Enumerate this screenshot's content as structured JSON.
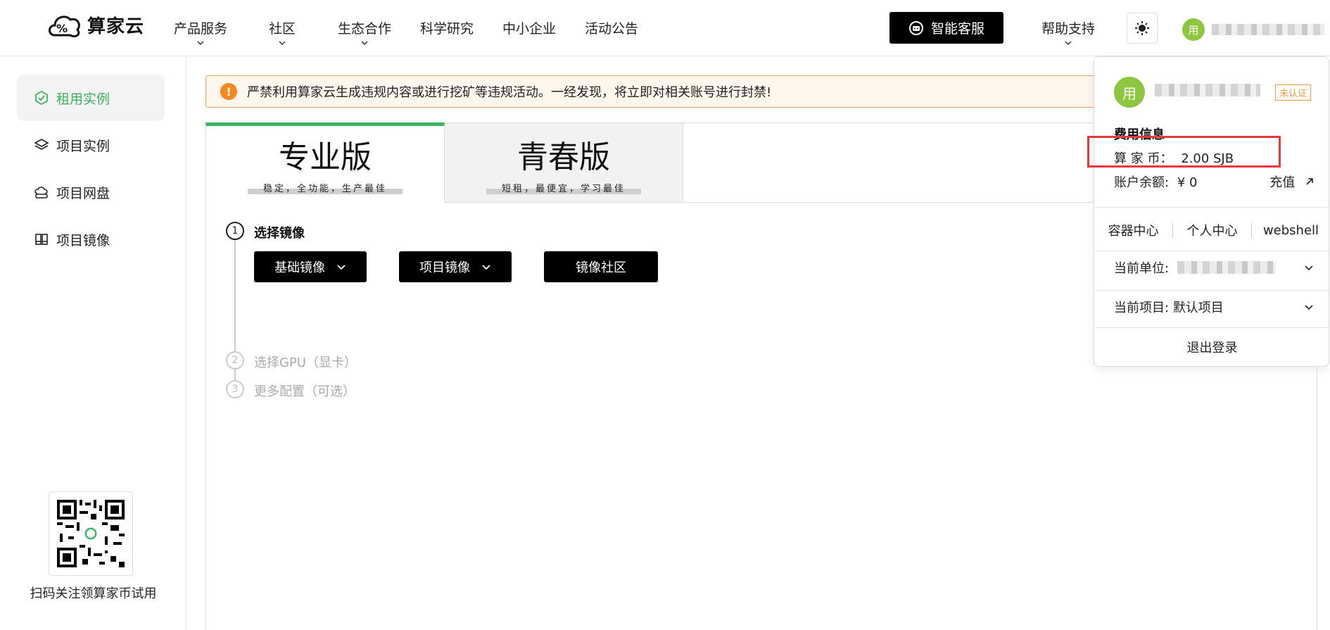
{
  "header": {
    "logo_text": "算家云",
    "nav": [
      "产品服务",
      "社区",
      "生态合作",
      "科学研究",
      "中小企业",
      "活动公告"
    ],
    "ai_service_label": "智能客服",
    "help_label": "帮助支持",
    "avatar_char": "用"
  },
  "sidebar": {
    "items": [
      {
        "label": "租用实例",
        "active": true
      },
      {
        "label": "项目实例",
        "active": false
      },
      {
        "label": "项目网盘",
        "active": false
      },
      {
        "label": "项目镜像",
        "active": false
      }
    ],
    "qr_caption": "扫码关注领算家币试用"
  },
  "notice": {
    "text": "严禁利用算家云生成违规内容或进行挖矿等违规活动。一经发现，将立即对相关账号进行封禁!"
  },
  "tabs": [
    {
      "title": "专业版",
      "subtitle": "稳定，全功能，生产最佳",
      "active": true
    },
    {
      "title": "青春版",
      "subtitle": "短租，最便宜，学习最佳",
      "active": false
    }
  ],
  "steps": [
    {
      "num": "1",
      "label": "选择镜像",
      "active": true
    },
    {
      "num": "2",
      "label": "选择GPU（显卡）",
      "active": false
    },
    {
      "num": "3",
      "label": "更多配置（可选）",
      "active": false
    }
  ],
  "image_buttons": {
    "base": "基础镜像",
    "project": "项目镜像",
    "community": "镜像社区"
  },
  "dropdown": {
    "avatar_char": "用",
    "badge": "未认证",
    "fee_title": "费用信息",
    "coin_label": "算 家 币：",
    "coin_value": "2.00 SJB",
    "balance_label": "账户余额:",
    "balance_value": "¥ 0",
    "recharge": "充值",
    "links": [
      "容器中心",
      "个人中心",
      "webshell"
    ],
    "unit_label": "当前单位:",
    "project_label": "当前项目:",
    "project_value": "默认项目",
    "logout": "退出登录"
  },
  "colors": {
    "accent_green": "#3cb35f",
    "avatar_green": "#8dc63f",
    "warning_orange": "#f7861f",
    "highlight_red": "#e8383d"
  }
}
